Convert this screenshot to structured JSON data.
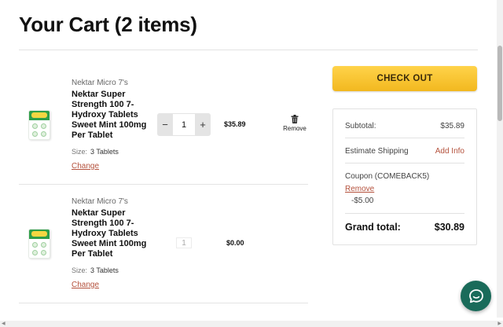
{
  "page": {
    "title": "Your Cart (2 items)"
  },
  "items": [
    {
      "brand": "Nektar Micro 7's",
      "name": "Nektar Super Strength 100 7-Hydroxy Tablets Sweet Mint 100mg Per Tablet",
      "size_label": "Size:",
      "size_value": "3 Tablets",
      "change_label": "Change",
      "qty_minus": "−",
      "qty": "1",
      "qty_plus": "+",
      "price": "$35.89",
      "remove_label": "Remove"
    },
    {
      "brand": "Nektar Micro 7's",
      "name": "Nektar Super Strength 100 7-Hydroxy Tablets Sweet Mint 100mg Per Tablet",
      "size_label": "Size:",
      "size_value": "3 Tablets",
      "change_label": "Change",
      "qty": "1",
      "price": "$0.00"
    }
  ],
  "checkout": {
    "label": "CHECK OUT"
  },
  "summary": {
    "subtotal_label": "Subtotal:",
    "subtotal_value": "$35.89",
    "shipping_label": "Estimate Shipping",
    "shipping_link": "Add Info",
    "coupon_label": "Coupon (COMEBACK5)",
    "coupon_remove": "Remove",
    "coupon_amount": "-$5.00",
    "grand_label": "Grand total:",
    "grand_value": "$30.89"
  },
  "colors": {
    "checkout_bg": "#f2b81f",
    "link": "#b4513c",
    "chat_bg": "#1a6b5a",
    "product_green": "#2e9e49"
  },
  "icons": {
    "remove": "trash-icon",
    "chat": "chat-bubble-icon",
    "product": "product-thumbnail"
  }
}
